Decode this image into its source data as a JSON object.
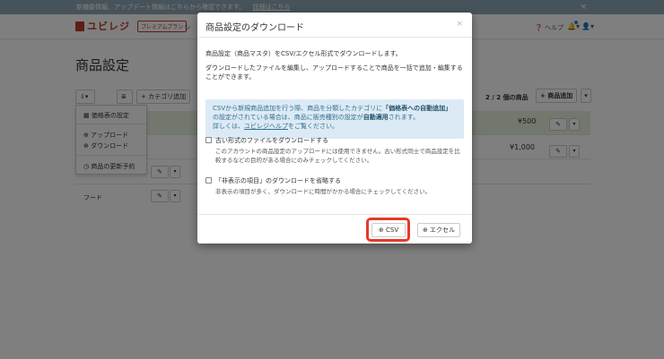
{
  "notice": {
    "text": "新機能情報、アップデート情報はこちらから確認できます。",
    "link": "詳細はこちら",
    "close": "×"
  },
  "navbar": {
    "logo_text": "ユビレジ",
    "premium": "プレミアムプラン",
    "nav_item": "シ",
    "help": "ヘルプ",
    "notif_icon": "bell-icon",
    "user_icon": "user-icon"
  },
  "page": {
    "title": "商品設定"
  },
  "toolbar": {
    "category_add": "+ カテゴリ追加",
    "count": "2 / 2 個の商品",
    "product_add": "+ 商品追加"
  },
  "dropdown": {
    "items": [
      "価格表の設定",
      "アップロード",
      "ダウンロード",
      "商品の更新予約"
    ]
  },
  "table": {
    "rows": [
      {
        "price": "¥500"
      },
      {
        "price": "¥1,000"
      }
    ],
    "category": "フード"
  },
  "modal": {
    "title": "商品設定のダウンロード",
    "close": "×",
    "desc1": "商品設定（商品マスタ）をCSV/エクセル形式でダウンロードします。",
    "desc2": "ダウンロードしたファイルを編集し、アップロードすることで商品を一括で追加・編集することができます。",
    "info_line1a": "CSVから新規商品追加を行う際、商品を分類したカテゴリに",
    "info_line1b": "「価格表への自動追加」",
    "info_line2a": "の設定がされている場合は、商品に販売種別の設定が",
    "info_line2b": "自動適用",
    "info_line2c": "されます。",
    "info_line3a": "詳しくは、",
    "info_line3b": "ユビレジヘルプ",
    "info_line3c": "をご覧ください。",
    "check1_label": "古い形式のファイルをダウンロードする",
    "check1_desc": "このアカウントの商品設定のアップロードには使用できません。古い形式同士で商品設定を比較するなどの目的がある場合にのみチェックしてください。",
    "check2_label": "「非表示の項目」のダウンロードを省略する",
    "check2_desc": "非表示の項目が多く、ダウンロードに時間がかかる場合にチェックしてください。",
    "csv_button": "CSV",
    "excel_button": "エクセル"
  }
}
